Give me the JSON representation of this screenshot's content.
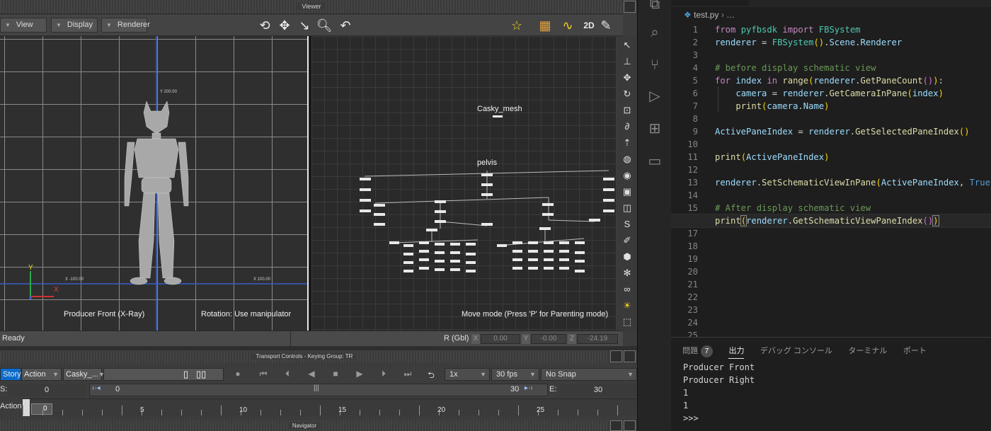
{
  "viewer": {
    "title": "Viewer",
    "menus": [
      "View",
      "Display",
      "Renderer"
    ],
    "left_pane": {
      "caption": "Producer Front (X-Ray)",
      "hint": "Rotation: Use manipulator",
      "coord_top": "Y 200.00",
      "coord_left": "X -100.00",
      "coord_right": "X 100.00",
      "axis_y": "Y",
      "axis_x": "X"
    },
    "right_pane": {
      "node_top": "Casky_mesh",
      "node_root": "pelvis",
      "hint": "Move mode (Press 'P' for Parenting mode)"
    }
  },
  "status": {
    "text": "Ready",
    "r_label": "R (Gbl)",
    "x_label": "X",
    "y_label": "Y",
    "z_label": "Z",
    "x_value": "0.00",
    "y_value": "-0.00",
    "z_value": "-24.19"
  },
  "transport": {
    "title": "Transport Controls  -  Keying Group: TR",
    "story": "Story",
    "action": "Action",
    "take": "Casky_...",
    "speed": "1x",
    "fps": "30 fps",
    "snap": "No Snap",
    "start_label": "S:",
    "start_value": "0",
    "range_start": "0",
    "range_end": "30",
    "end_label": "E:",
    "end_value": "30",
    "track_label": "Action",
    "current_frame": "0",
    "ticks": [
      "5",
      "10",
      "15",
      "20",
      "25"
    ]
  },
  "navigator": {
    "title": "Navigator"
  },
  "editor": {
    "breadcrumb_file": "test.py",
    "breadcrumb_rest": "…",
    "line_numbers": [
      "1",
      "2",
      "3",
      "4",
      "5",
      "6",
      "7",
      "8",
      "9",
      "10",
      "11",
      "12",
      "13",
      "14",
      "15",
      "16",
      "17",
      "18",
      "19",
      "20",
      "21",
      "22",
      "23",
      "24",
      "25"
    ]
  },
  "panel": {
    "tabs": [
      "問題",
      "出力",
      "デバッグ コンソール",
      "ターミナル",
      "ポート"
    ],
    "problems_count": "7",
    "output_lines": [
      "Producer Front",
      "Producer Right",
      "1",
      "1",
      ">>>"
    ]
  },
  "colors": {
    "accent": "#4a9fd8",
    "selection_blue": "#0a6ccc",
    "keyword": "#c586c0",
    "function": "#dcdcaa",
    "class": "#4ec9b0",
    "comment": "#6a9955"
  }
}
